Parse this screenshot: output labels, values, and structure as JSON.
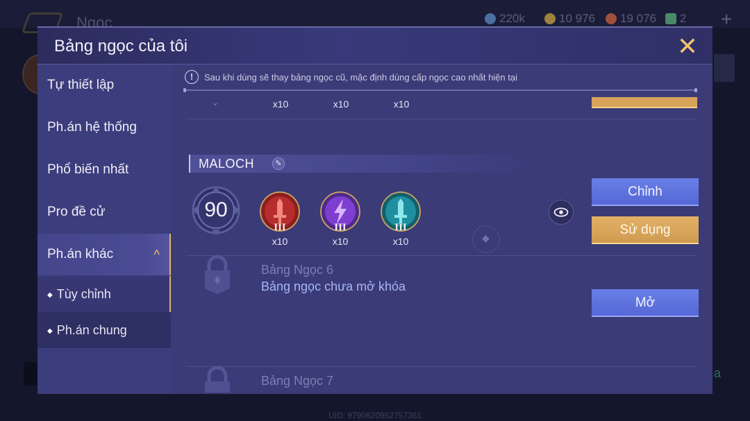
{
  "background": {
    "title": "Ngọc",
    "resources": [
      {
        "name": "blue-gem-icon",
        "value": "220k",
        "color": "#4a6fa0"
      },
      {
        "name": "gold-coin-icon",
        "value": "10 976",
        "color": "#a0823c"
      },
      {
        "name": "red-gem-icon",
        "value": "19 076",
        "color": "#a0503c"
      },
      {
        "name": "green-card-icon",
        "value": "2",
        "color": "#4a8a6a"
      }
    ],
    "uid": "UID: 9790620952757361"
  },
  "modal": {
    "title": "Bảng ngọc của tôi",
    "close_label": "✕"
  },
  "sidebar": {
    "items": [
      {
        "label": "Tự thiết lập"
      },
      {
        "label": "Ph.án hệ thống"
      },
      {
        "label": "Phổ biến nhất"
      },
      {
        "label": "Pro đề cử"
      },
      {
        "label": "Ph.án khác",
        "expanded": true
      }
    ],
    "subitems": [
      {
        "label": "Tùy chỉnh",
        "active": true
      },
      {
        "label": "Ph.án chung",
        "active": false
      }
    ]
  },
  "content": {
    "notice": "Sau khi dùng sẽ thay bảng ngọc cũ, mặc định dùng cấp ngọc cao nhất hiện tại",
    "prev_set_quantities": [
      "x10",
      "x10",
      "x10"
    ],
    "rune_set": {
      "name": "MALOCH",
      "level": "90",
      "runes": [
        {
          "icon": "red-sword-rune-icon",
          "tier": "III",
          "quantity": "x10",
          "color": "#b72d2d"
        },
        {
          "icon": "purple-lightning-rune-icon",
          "tier": "III",
          "quantity": "x10",
          "color": "#7e3fd1"
        },
        {
          "icon": "teal-sword-rune-icon",
          "tier": "III",
          "quantity": "x10",
          "color": "#1f8fa0"
        }
      ],
      "edit_label": "Chỉnh",
      "use_label": "Sử dụng"
    },
    "locked_sets": [
      {
        "title": "Bảng Ngọc 6",
        "subtitle": "Bảng ngọc chưa mở khóa",
        "open_label": "Mở"
      },
      {
        "title": "Bảng Ngọc 7"
      }
    ]
  }
}
